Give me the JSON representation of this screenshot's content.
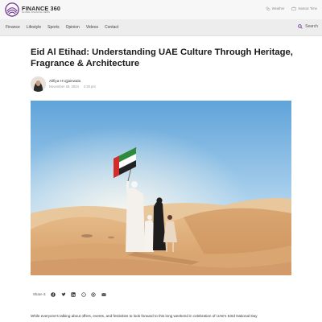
{
  "site": {
    "name": "FINANCE 360",
    "tagline": "GLOBAL FINANCIAL NEWS"
  },
  "top_links": [
    {
      "icon": "weather-icon",
      "label": "Weather"
    },
    {
      "icon": "prayer-icon",
      "label": "Namaz Time"
    }
  ],
  "nav": {
    "items": [
      "Finance",
      "Lifestyle",
      "Sports",
      "Opinion",
      "Videos",
      "Contact"
    ],
    "search_label": "Search"
  },
  "article": {
    "headline": "Eid Al Etihad: Understanding UAE Culture Through Heritage, Fragrance & Architecture",
    "author": "Alifiya H Ujjainwala",
    "date": "November 29, 2024",
    "time": "4:30 pm",
    "share_label": "Share it:",
    "share_icons": [
      "facebook-icon",
      "twitter-icon",
      "linkedin-icon",
      "whatsapp-icon",
      "threads-icon",
      "email-icon"
    ],
    "body": "While everyone's talking about offers, events, and festivities to look forward to this long weekend in celebration of UAE's 53rd National Day"
  },
  "colors": {
    "brand": "#6a2f8f",
    "nav_bg": "#ededed",
    "topbar_bg": "#f7f7f7"
  }
}
